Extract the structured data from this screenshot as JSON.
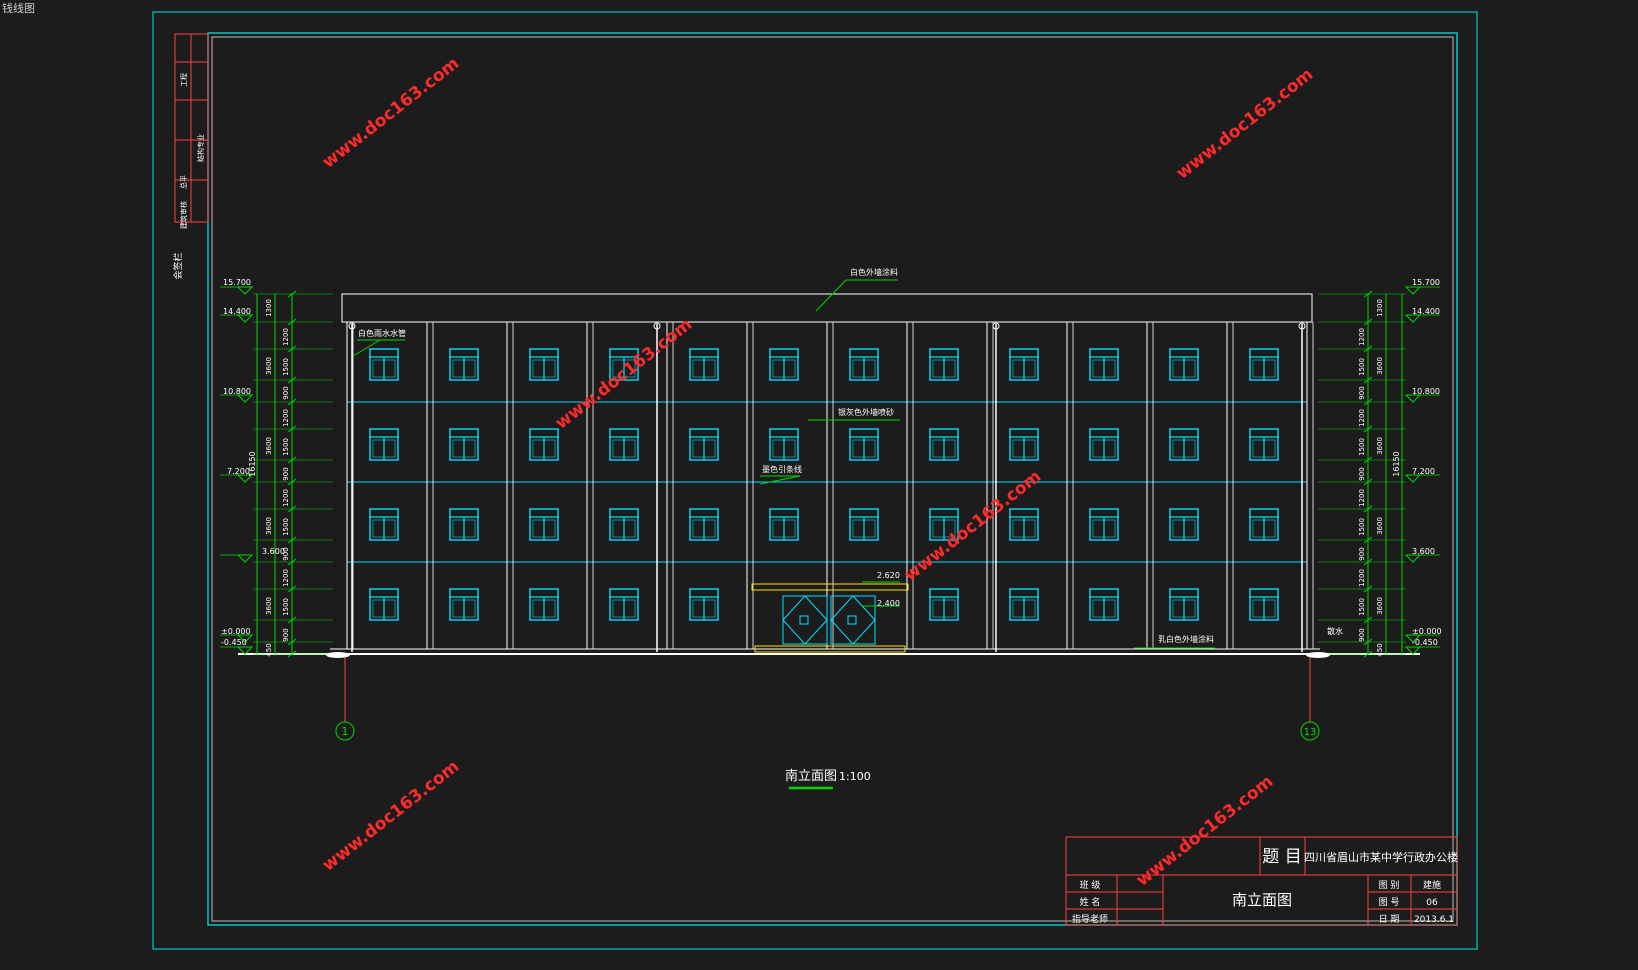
{
  "window": {
    "corner_label": "钱线图"
  },
  "left_strip": {
    "labels": [
      "工程",
      "结构专业",
      "总平",
      "建筑审核"
    ],
    "side_note": "会签栏"
  },
  "watermark": "www.doc163.com",
  "elevation": {
    "levels_left": [
      "15.700",
      "14.400",
      "10.800",
      "7.200",
      "3.600",
      "±0.000",
      "-0.450"
    ],
    "levels_right": [
      "15.700",
      "14.400",
      "10.800",
      "7.200",
      "3.600",
      "±0.000",
      "-0.450"
    ],
    "door_levels": [
      "2.620",
      "2.400"
    ],
    "dims_inner": [
      "1300",
      "1200",
      "1500",
      "900",
      "1200",
      "1500",
      "900",
      "1200",
      "1500",
      "900",
      "1200",
      "1500",
      "900",
      "450"
    ],
    "dims_outer": [
      "3600",
      "3600",
      "3600",
      "3600"
    ],
    "total_height": "16150",
    "annotations": [
      "白色外墙涂料",
      "白色雨水水管",
      "银灰色外墙喷砂",
      "墨色引条线",
      "乳白色外墙涂料",
      "散水"
    ],
    "axis_left": "1",
    "axis_right": "13",
    "drawing_title": "南立面图",
    "scale": "1:100"
  },
  "title_block": {
    "title_label": "题 目",
    "project": "四川省眉山市某中学行政办公楼",
    "rows_left": [
      "班 级",
      "姓 名",
      "指导老师"
    ],
    "drawing_name": "南立面图",
    "info_labels": [
      "图 别",
      "图 号",
      "日 期"
    ],
    "info_values": [
      "建施",
      "06",
      "2013.6.1"
    ]
  },
  "colors": {
    "background": "#1c1c1c",
    "frame": "#00c8c8",
    "lines": "#ffffff",
    "windows": "#00e0ff",
    "dims": "#00d800",
    "watermark": "#ff2a2a",
    "door": "#ffe000"
  }
}
